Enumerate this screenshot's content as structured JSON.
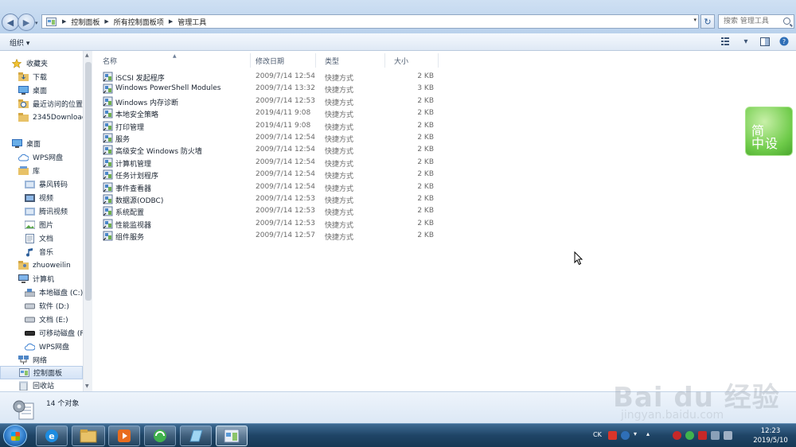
{
  "address": {
    "crumbs": [
      "控制面板",
      "所有控制面板项",
      "管理工具"
    ],
    "search_placeholder": "搜索 管理工具"
  },
  "toolbar": {
    "organize_label": "组织 ▾"
  },
  "sidebar": {
    "items": [
      {
        "label": "收藏夹",
        "icon": "star-icon"
      },
      {
        "label": "下载",
        "icon": "download-folder-icon"
      },
      {
        "label": "桌面",
        "icon": "desktop-icon"
      },
      {
        "label": "最近访问的位置",
        "icon": "recent-places-icon"
      },
      {
        "label": "2345Downloads",
        "icon": "folder-icon"
      },
      {
        "label": "桌面",
        "icon": "desktop-icon"
      },
      {
        "label": "WPS网盘",
        "icon": "cloud-icon"
      },
      {
        "label": "库",
        "icon": "library-icon"
      },
      {
        "label": "暴风转码",
        "icon": "library-folder-icon"
      },
      {
        "label": "视频",
        "icon": "video-icon"
      },
      {
        "label": "腾讯视频",
        "icon": "library-folder-icon"
      },
      {
        "label": "图片",
        "icon": "picture-icon"
      },
      {
        "label": "文档",
        "icon": "document-icon"
      },
      {
        "label": "音乐",
        "icon": "music-icon"
      },
      {
        "label": "zhuoweilin",
        "icon": "user-folder-icon"
      },
      {
        "label": "计算机",
        "icon": "computer-icon"
      },
      {
        "label": "本地磁盘 (C:)",
        "icon": "drive-icon"
      },
      {
        "label": "软件 (D:)",
        "icon": "drive-icon"
      },
      {
        "label": "文档 (E:)",
        "icon": "drive-icon"
      },
      {
        "label": "可移动磁盘 (F:)",
        "icon": "removable-drive-icon"
      },
      {
        "label": "WPS网盘",
        "icon": "cloud-icon"
      },
      {
        "label": "网络",
        "icon": "network-icon"
      },
      {
        "label": "控制面板",
        "icon": "control-panel-icon"
      },
      {
        "label": "回收站",
        "icon": "recycle-bin-icon"
      }
    ]
  },
  "columns": {
    "name": "名称",
    "date": "修改日期",
    "type": "类型",
    "size": "大小"
  },
  "files": [
    {
      "name": "iSCSI 发起程序",
      "date": "2009/7/14 12:54",
      "type": "快捷方式",
      "size": "2 KB"
    },
    {
      "name": "Windows PowerShell Modules",
      "date": "2009/7/14 13:32",
      "type": "快捷方式",
      "size": "3 KB"
    },
    {
      "name": "Windows 内存诊断",
      "date": "2009/7/14 12:53",
      "type": "快捷方式",
      "size": "2 KB"
    },
    {
      "name": "本地安全策略",
      "date": "2019/4/11 9:08",
      "type": "快捷方式",
      "size": "2 KB"
    },
    {
      "name": "打印管理",
      "date": "2019/4/11 9:08",
      "type": "快捷方式",
      "size": "2 KB"
    },
    {
      "name": "服务",
      "date": "2009/7/14 12:54",
      "type": "快捷方式",
      "size": "2 KB"
    },
    {
      "name": "高级安全 Windows 防火墙",
      "date": "2009/7/14 12:54",
      "type": "快捷方式",
      "size": "2 KB"
    },
    {
      "name": "计算机管理",
      "date": "2009/7/14 12:54",
      "type": "快捷方式",
      "size": "2 KB"
    },
    {
      "name": "任务计划程序",
      "date": "2009/7/14 12:54",
      "type": "快捷方式",
      "size": "2 KB"
    },
    {
      "name": "事件查看器",
      "date": "2009/7/14 12:54",
      "type": "快捷方式",
      "size": "2 KB"
    },
    {
      "name": "数据源(ODBC)",
      "date": "2009/7/14 12:53",
      "type": "快捷方式",
      "size": "2 KB"
    },
    {
      "name": "系统配置",
      "date": "2009/7/14 12:53",
      "type": "快捷方式",
      "size": "2 KB"
    },
    {
      "name": "性能监视器",
      "date": "2009/7/14 12:53",
      "type": "快捷方式",
      "size": "2 KB"
    },
    {
      "name": "组件服务",
      "date": "2009/7/14 12:57",
      "type": "快捷方式",
      "size": "2 KB"
    }
  ],
  "details": {
    "count_label": "14 个对象"
  },
  "gadget": {
    "text": "简\n中设"
  },
  "watermark": {
    "brand": "Bai du 经验",
    "url": "jingyan.baidu.com"
  },
  "taskbar": {
    "lang": "CK",
    "time": "12:23",
    "date": "2019/5/10"
  },
  "colors": {
    "accent": "#2a76c4",
    "taskbar": "#1f4466",
    "selection": "#d4e3f6"
  }
}
